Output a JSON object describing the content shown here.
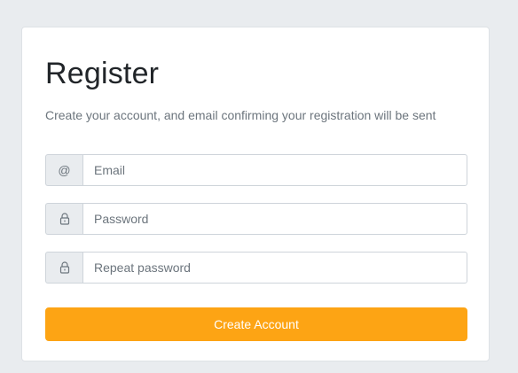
{
  "register": {
    "title": "Register",
    "subtitle": "Create your account, and email confirming your registration will be sent",
    "fields": [
      {
        "icon": "at-sign-icon",
        "addon_text": "@",
        "placeholder": "Email",
        "value": ""
      },
      {
        "icon": "lock-icon",
        "placeholder": "Password",
        "value": ""
      },
      {
        "icon": "lock-icon",
        "placeholder": "Repeat password",
        "value": ""
      }
    ],
    "submit_label": "Create Account"
  },
  "colors": {
    "accent": "#fda414",
    "page_background": "#e9ecef",
    "card_background": "#ffffff",
    "addon_background": "#e9ecef",
    "border": "#ced4da",
    "title_text": "#212529",
    "muted_text": "#6c757d"
  }
}
